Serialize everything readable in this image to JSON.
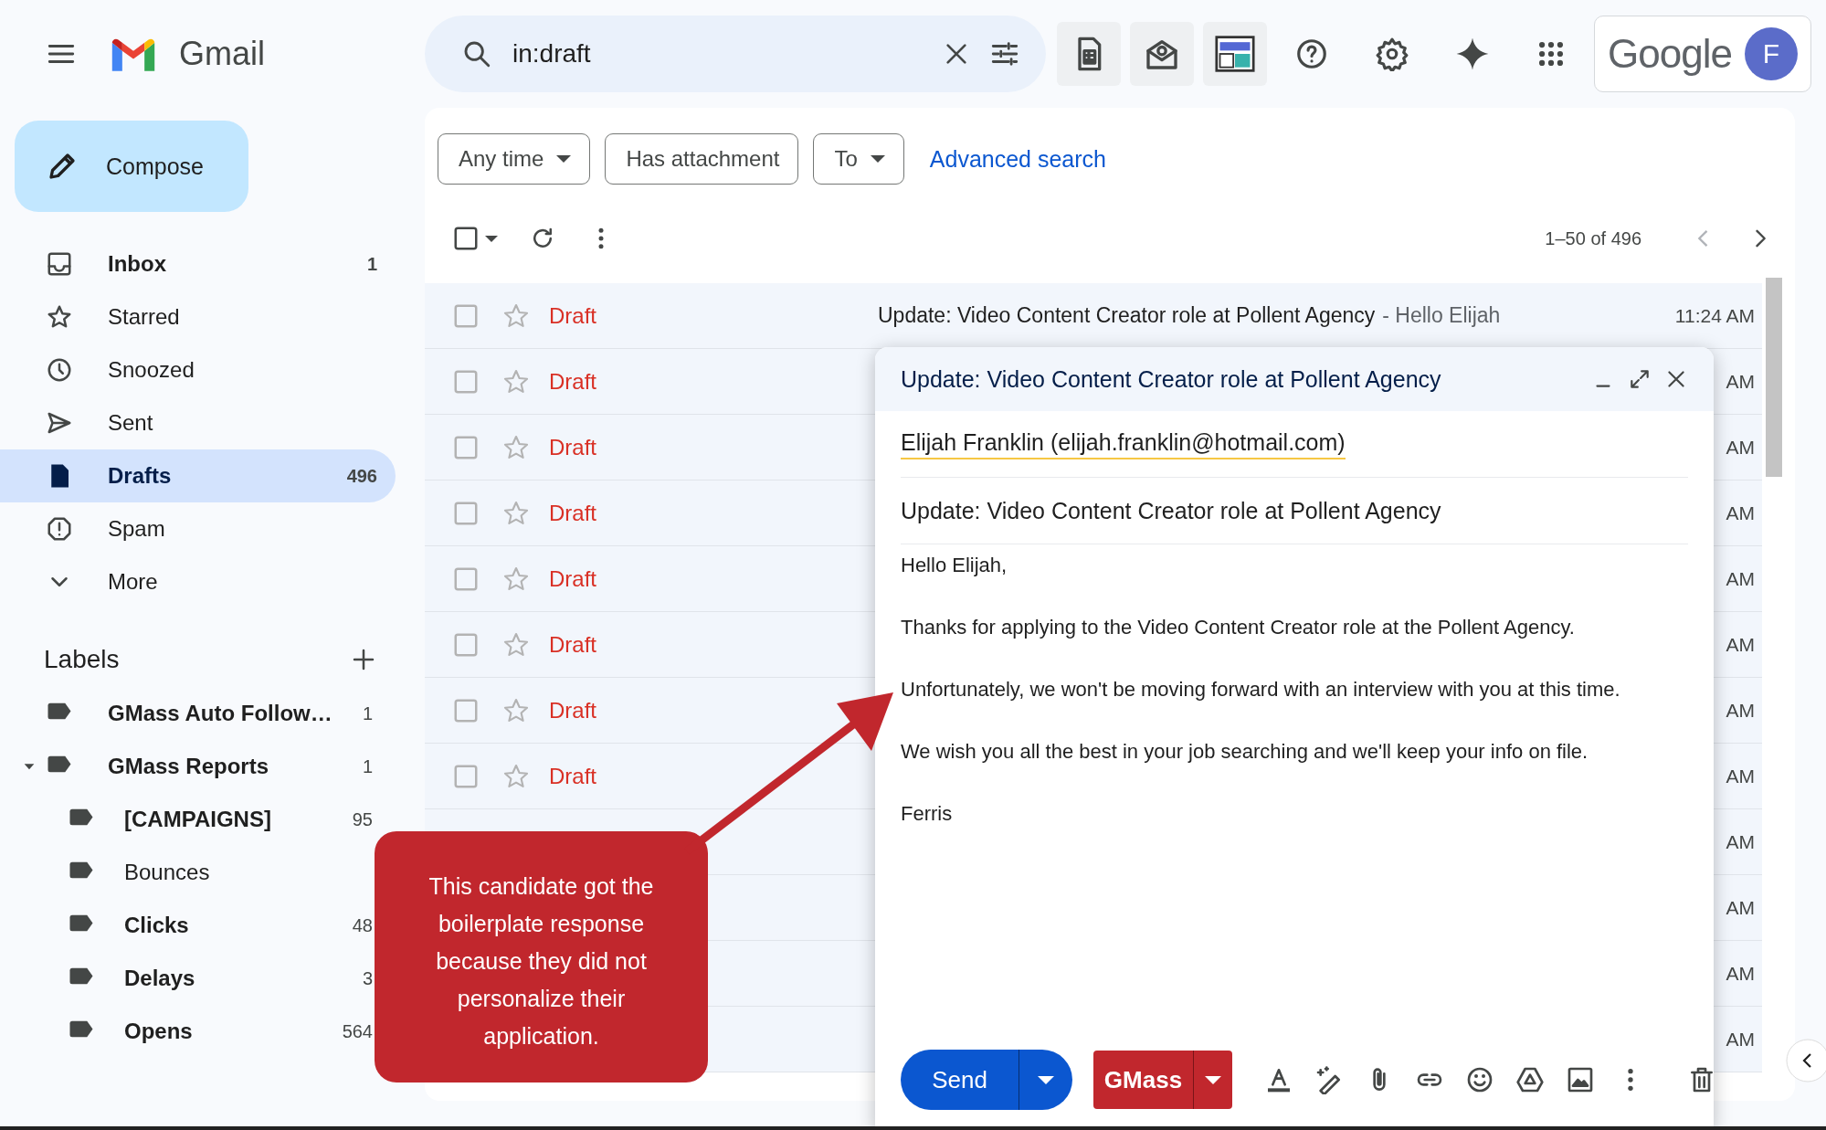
{
  "header": {
    "app_name": "Gmail",
    "search": {
      "value": "in:draft"
    },
    "brand": "Google",
    "avatar": "F"
  },
  "compose_button": "Compose",
  "nav": [
    {
      "kind": "inbox",
      "label": "Inbox",
      "count": "1",
      "unread": true,
      "selected": false
    },
    {
      "kind": "star",
      "label": "Starred",
      "unread": false,
      "selected": false
    },
    {
      "kind": "clock",
      "label": "Snoozed",
      "unread": false,
      "selected": false
    },
    {
      "kind": "send",
      "label": "Sent",
      "unread": false,
      "selected": false
    },
    {
      "kind": "file",
      "label": "Drafts",
      "count": "496",
      "unread": true,
      "selected": true
    },
    {
      "kind": "alert",
      "label": "Spam",
      "unread": false,
      "selected": false
    },
    {
      "kind": "chevron",
      "label": "More",
      "unread": false,
      "selected": false
    }
  ],
  "labels": {
    "title": "Labels",
    "items": [
      {
        "name": "GMass Auto Follow…",
        "count": "1",
        "unread": true
      },
      {
        "name": "GMass Reports",
        "count": "1",
        "unread": true,
        "expanded": true,
        "children": [
          {
            "name": "[CAMPAIGNS]",
            "count": "95",
            "unread": true
          },
          {
            "name": "Bounces",
            "unread": false
          },
          {
            "name": "Clicks",
            "count": "48",
            "unread": true
          },
          {
            "name": "Delays",
            "count": "3",
            "unread": true
          },
          {
            "name": "Opens",
            "count": "564",
            "unread": true
          }
        ]
      }
    ]
  },
  "filters": [
    {
      "kind": "dropdown",
      "label": "Any time"
    },
    {
      "kind": "chip",
      "label": "Has attachment"
    },
    {
      "kind": "dropdown",
      "label": "To"
    }
  ],
  "advanced_search": "Advanced search",
  "select_all": {
    "checked": false
  },
  "pagination": "1–50 of 496",
  "rows": [
    {
      "label": "Draft",
      "subject": "Update: Video Content Creator role at Pollent Agency",
      "snippet": "- Hello Elijah",
      "time": "11:24 AM",
      "checked": false,
      "starred": false
    },
    {
      "label": "Draft",
      "time": "AM",
      "checked": false,
      "starred": false
    },
    {
      "label": "Draft",
      "time": "AM",
      "checked": false,
      "starred": false
    },
    {
      "label": "Draft",
      "time": "AM",
      "checked": false,
      "starred": false
    },
    {
      "label": "Draft",
      "time": "AM",
      "checked": false,
      "starred": false
    },
    {
      "label": "Draft",
      "time": "AM",
      "checked": false,
      "starred": false
    },
    {
      "label": "Draft",
      "time": "AM",
      "checked": false,
      "starred": false
    },
    {
      "label": "Draft",
      "time": "AM",
      "checked": false,
      "starred": false
    },
    {
      "time": "AM"
    },
    {
      "time": "AM"
    },
    {
      "time": "AM"
    },
    {
      "time": "AM"
    }
  ],
  "compose": {
    "title": "Update: Video Content Creator role at Pollent Agency",
    "to": "Elijah Franklin (elijah.franklin@hotmail.com)",
    "subject": "Update: Video Content Creator role at Pollent Agency",
    "body": [
      "Hello Elijah,",
      "Thanks for applying to the Video Content Creator role at the Pollent Agency.",
      "Unfortunately, we won't be moving forward with an interview with you at this time.",
      "We wish you all the best in your job searching and we'll keep your info on file.",
      "Ferris"
    ],
    "send": "Send",
    "gmass": "GMass"
  },
  "callout": "This candidate got the boilerplate response because they did not personalize their application."
}
